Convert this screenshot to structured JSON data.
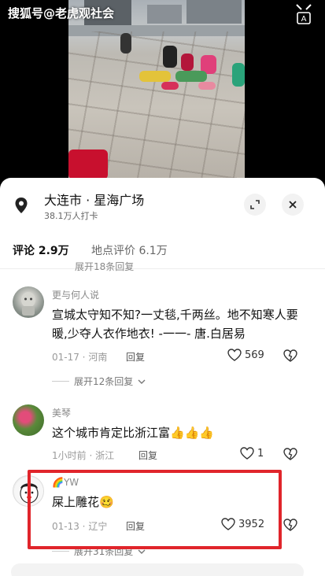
{
  "video": {
    "watermark": "搜狐号@老虎观社会",
    "translate_icon": "translate-icon"
  },
  "location": {
    "title": "大连市 · 星海广场",
    "subtitle": "38.1万人打卡",
    "pin_icon": "location-pin-icon",
    "expand_icon": "expand-icon",
    "close_icon": "close-icon"
  },
  "tabs": [
    {
      "label": "评论 2.9万"
    },
    {
      "label": "地点评价 6.1万"
    }
  ],
  "partial_expand_text": "展开18条回复",
  "comments": [
    {
      "name": "更与何人说",
      "text": "宣城太守知不知?一丈毯,千两丝。地不知寒人要暖,少夺人衣作地衣!  -一一- 唐.白居易",
      "date": "01-17 · 河南",
      "reply": "回复",
      "likes": "569",
      "expand": "展开12条回复"
    },
    {
      "name": "美琴",
      "text": "这个城市肯定比浙江富👍👍👍",
      "date": "1小时前 · 浙江",
      "reply": "回复",
      "likes": "1"
    },
    {
      "name": "🌈YW",
      "text": "屎上雕花🥴",
      "date": "01-13 · 辽宁",
      "reply": "回复",
      "likes": "3952",
      "expand": "展开31条回复"
    }
  ],
  "colors": {
    "highlight_border": "#e0252b",
    "sheet_bg": "#ffffff"
  }
}
